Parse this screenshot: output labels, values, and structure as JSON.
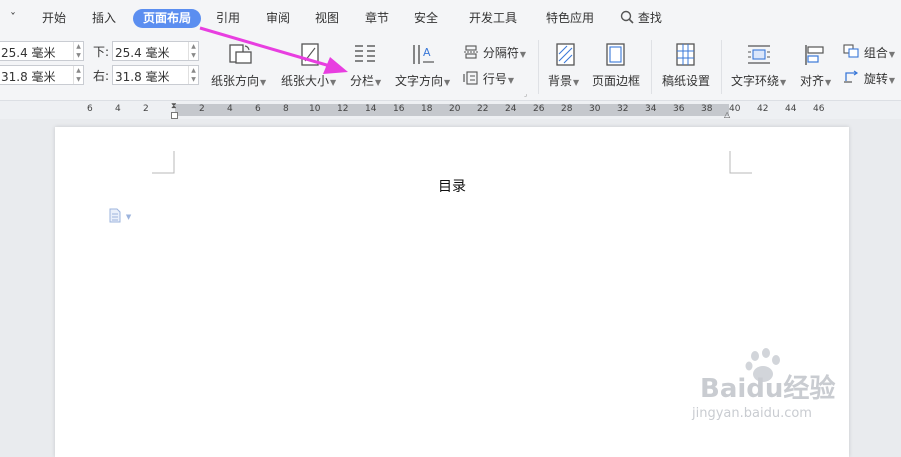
{
  "tabs": {
    "collapse": "ˇ",
    "start": "开始",
    "insert": "插入",
    "page_layout": "页面布局",
    "reference": "引用",
    "review": "审阅",
    "view": "视图",
    "section": "章节",
    "security": "安全",
    "developer": "开发工具",
    "special": "特色应用",
    "search": "查找"
  },
  "margins": {
    "top_value": "25.4 毫米",
    "bottom_label": "下:",
    "bottom_value": "25.4 毫米",
    "left_value": "31.8 毫米",
    "right_label": "右:",
    "right_value": "31.8 毫米"
  },
  "ribbon": {
    "paper_orientation": "纸张方向",
    "paper_size": "纸张大小",
    "columns": "分栏",
    "text_direction": "文字方向",
    "separator": "分隔符",
    "line_number": "行号",
    "background": "背景",
    "page_border": "页面边框",
    "manuscript": "稿纸设置",
    "text_wrap": "文字环绕",
    "align": "对齐",
    "group": "组合",
    "rotate": "旋转"
  },
  "ruler": {
    "numbers": [
      "6",
      "4",
      "2",
      "2",
      "4",
      "6",
      "8",
      "10",
      "12",
      "14",
      "16",
      "18",
      "20",
      "22",
      "24",
      "26",
      "28",
      "30",
      "32",
      "34",
      "36",
      "38",
      "40",
      "42",
      "44",
      "46"
    ]
  },
  "document": {
    "title": "目录"
  },
  "watermark": {
    "brand": "Baidu经验",
    "url": "jingyan.baidu.com"
  },
  "colors": {
    "active_tab": "#5b8ef0",
    "annotation_arrow": "#e83ee0"
  }
}
